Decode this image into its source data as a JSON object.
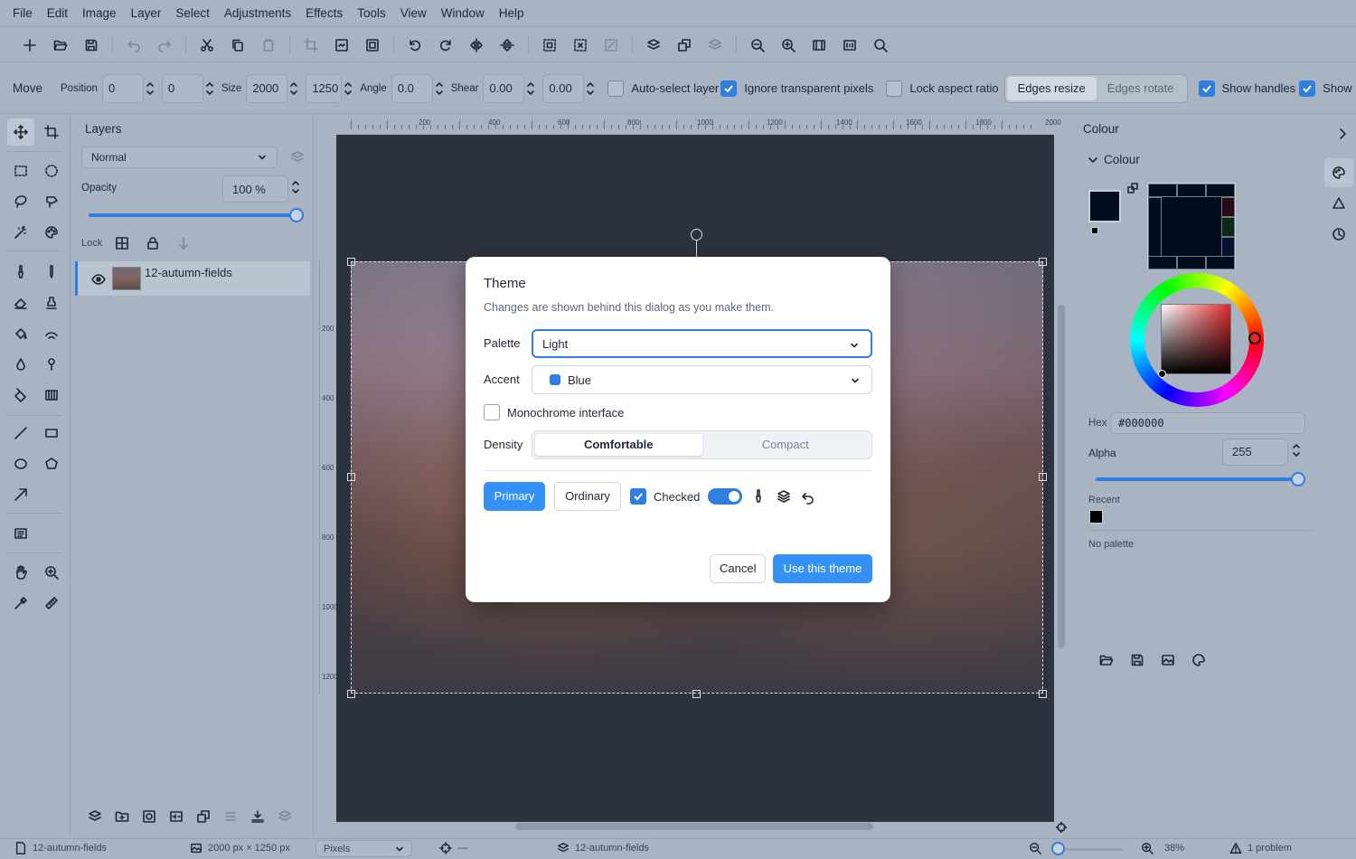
{
  "menubar": [
    "File",
    "Edit",
    "Image",
    "Layer",
    "Select",
    "Adjustments",
    "Effects",
    "Tools",
    "View",
    "Window",
    "Help"
  ],
  "options": {
    "tool_name": "Move",
    "position_label": "Position",
    "position_x": "0",
    "position_y": "0",
    "size_label": "Size",
    "size_w": "2000",
    "size_h": "1250",
    "angle_label": "Angle",
    "angle": "0.0",
    "shear_label": "Shear",
    "shear_x": "0.00",
    "shear_y": "0.00",
    "auto_select": "Auto-select layer",
    "ignore_transparent": "Ignore transparent pixels",
    "lock_aspect": "Lock aspect ratio",
    "edges_resize": "Edges resize",
    "edges_rotate": "Edges rotate",
    "show_handles": "Show handles",
    "show_more": "Show r"
  },
  "layers": {
    "title": "Layers",
    "blend_mode": "Normal",
    "opacity_label": "Opacity",
    "opacity_value": "100 %",
    "opacity_fraction": 1.0,
    "lock_label": "Lock",
    "items": [
      {
        "name": "12-autumn-fields"
      }
    ]
  },
  "ruler": {
    "h_ticks": [
      "200",
      "400",
      "600",
      "800",
      "1000",
      "1200",
      "1400",
      "1600",
      "1800",
      "2000"
    ],
    "v_ticks": [
      "200",
      "400",
      "600",
      "800",
      "1000",
      "1200"
    ]
  },
  "colour": {
    "title": "Colour",
    "section": "Colour",
    "hex_label": "Hex",
    "hex_value": "#000000",
    "alpha_label": "Alpha",
    "alpha_value": "255",
    "recent_label": "Recent",
    "no_palette": "No palette"
  },
  "status": {
    "document": "12-autumn-fields",
    "dimensions": "2000 px × 1250 px",
    "units": "Pixels",
    "cursor": "—",
    "layer": "12-autumn-fields",
    "zoom": "38%",
    "problems": "1 problem"
  },
  "dialog": {
    "title": "Theme",
    "subtitle": "Changes are shown behind this dialog as you make them.",
    "palette_label": "Palette",
    "palette_value": "Light",
    "accent_label": "Accent",
    "accent_value": "Blue",
    "monochrome_label": "Monochrome interface",
    "density_label": "Density",
    "density_options": [
      "Comfortable",
      "Compact"
    ],
    "density_selected": "Comfortable",
    "preview_primary": "Primary",
    "preview_ordinary": "Ordinary",
    "preview_checked": "Checked",
    "cancel": "Cancel",
    "confirm": "Use this theme"
  },
  "colors": {
    "accent": "#2f7ee0",
    "primary_button": "#3591f3",
    "canvas_bg": "#2c333e",
    "chrome_bg": "#a9b4c2"
  }
}
